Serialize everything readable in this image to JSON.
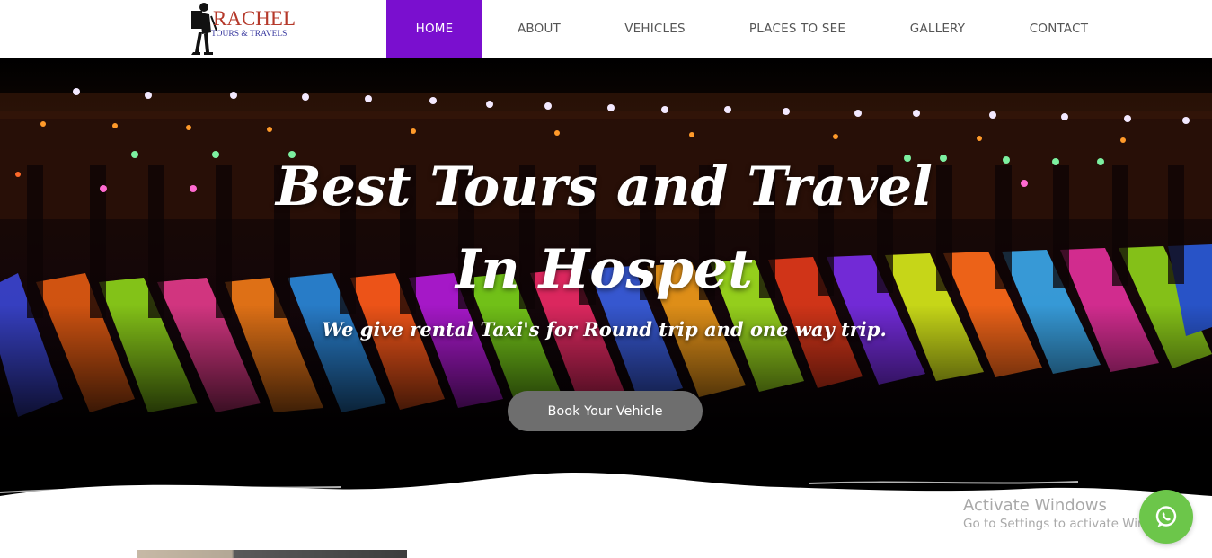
{
  "header": {
    "logo": {
      "name": "RACHEL",
      "tagline": "TOURS & TRAVELS"
    },
    "nav": [
      {
        "label": "HOME",
        "active": true
      },
      {
        "label": "ABOUT",
        "active": false
      },
      {
        "label": "VEHICLES",
        "active": false
      },
      {
        "label": "PLACES TO SEE",
        "active": false
      },
      {
        "label": "GALLERY",
        "active": false
      },
      {
        "label": "CONTACT",
        "active": false
      }
    ]
  },
  "hero": {
    "title": "Best Tours and Travel In Hospet",
    "subtitle": "We give rental Taxi's for Round trip and one way trip.",
    "button_label": "Book Your Vehicle"
  },
  "overlay": {
    "activate_title": "Activate Windows",
    "activate_sub": "Go to Settings to activate Windows."
  },
  "colors": {
    "accent": "#7a0fcf",
    "button": "#6e6e6e",
    "whatsapp": "#6cc64a"
  },
  "icons": {
    "logo": "hiker-icon",
    "chat": "whatsapp-icon"
  }
}
